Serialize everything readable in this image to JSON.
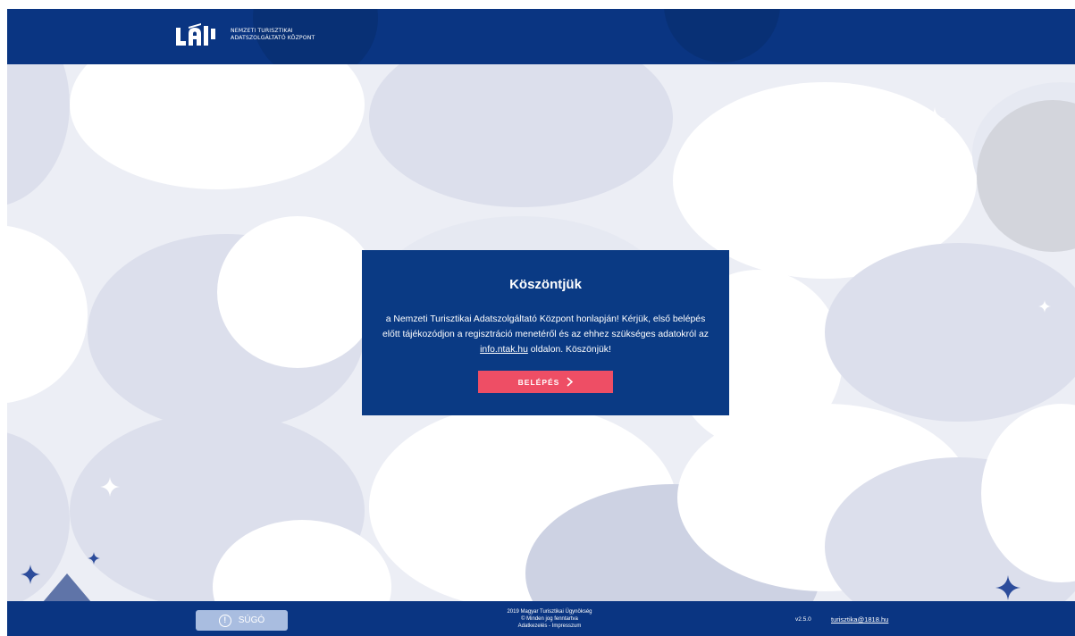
{
  "header": {
    "logo_line1": "NEMZETI TURISZTIKAI",
    "logo_line2": "ADATSZOLGÁLTATÓ KÖZPONT"
  },
  "welcome": {
    "title": "Köszöntjük",
    "text_before": "a Nemzeti Turisztikai Adatszolgáltató Központ honlapján! Kérjük, első belépés előtt tájékozódjon a regisztráció menetéről és az ehhez szükséges adatokról az ",
    "link": "info.ntak.hu",
    "text_after": " oldalon. Köszönjük!",
    "login_label": "BELÉPÉS"
  },
  "footer": {
    "help_label": "SÚGÓ",
    "help_icon": "!",
    "copyright_line1": "2019 Magyar Turisztikai Ügynökség",
    "copyright_line2": "© Minden jog fenntartva",
    "policy_link": "Adatkezelés",
    "separator": " - ",
    "imprint_link": "Impresszum",
    "version": "v2.5.0",
    "email": "turisztika@1818.hu"
  },
  "colors": {
    "brand_blue": "#0a3582",
    "card_blue": "#0a3a84",
    "accent_pink": "#ee4e65",
    "help_button": "#a9bde0"
  },
  "icons": [
    "ntak-logo-icon",
    "chevron-right-icon",
    "info-circle-icon",
    "sparkle-icon"
  ]
}
